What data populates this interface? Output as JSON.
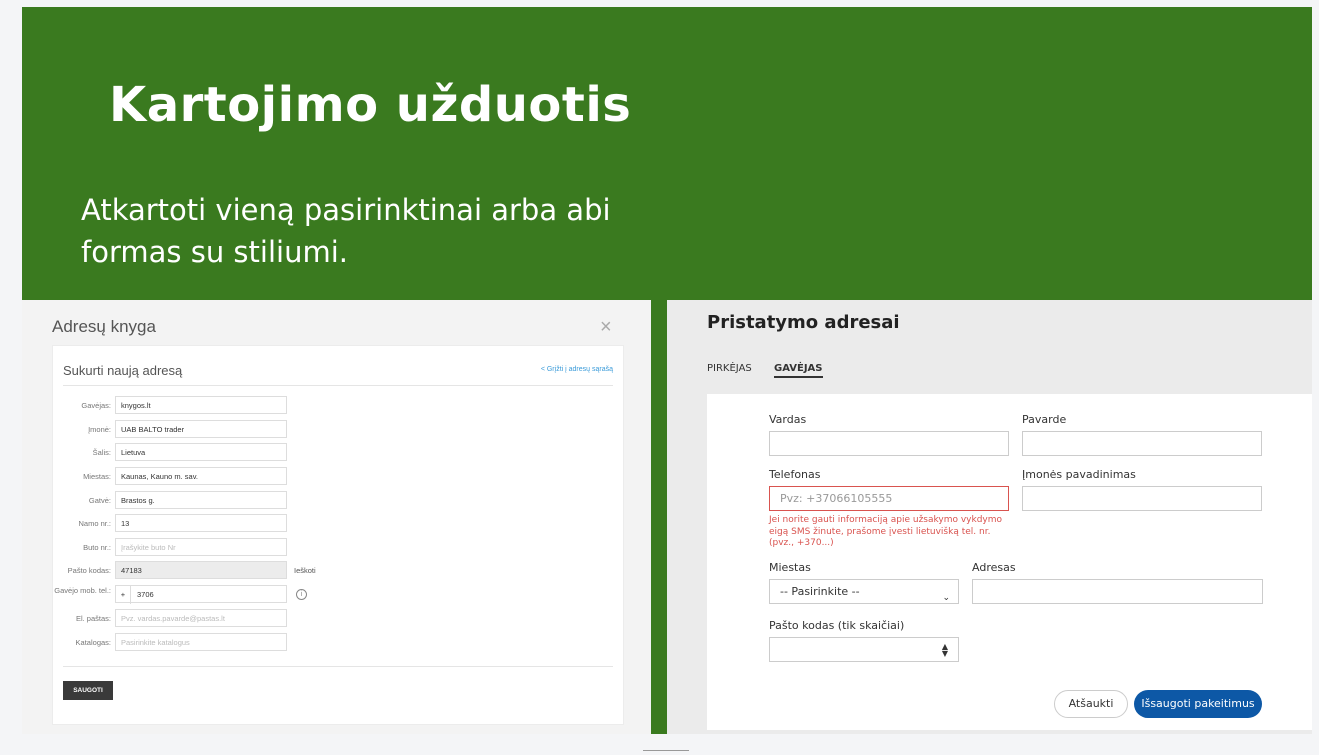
{
  "slide": {
    "title": "Kartojimo užduotis",
    "subtitle_line1": "Atkartoti vieną pasirinktinai arba abi",
    "subtitle_line2": "formas su stiliumi.",
    "bg_color": "#3a7a1f"
  },
  "left_form": {
    "modal_title": "Adresų knyga",
    "close_icon": "×",
    "heading": "Sukurti naują adresą",
    "back_link": "< Grįžti į adresų sąrašą",
    "fields": [
      {
        "label": "Gavėjas:",
        "value": "knygos.lt"
      },
      {
        "label": "Įmonė:",
        "value": "UAB BALTO trader"
      },
      {
        "label": "Šalis:",
        "value": "Lietuva"
      },
      {
        "label": "Miestas:",
        "value": "Kaunas, Kauno m. sav."
      },
      {
        "label": "Gatvė:",
        "value": "Brastos g."
      },
      {
        "label": "Namo nr.:",
        "value": "13"
      },
      {
        "label": "Buto nr.:",
        "placeholder": "Įrašykite buto Nr"
      },
      {
        "label": "Pašto kodas:",
        "value": "47183",
        "extra": "Ieškoti"
      },
      {
        "label": "Gavėjo mob. tel.:",
        "prefix": "+",
        "value": "3706"
      },
      {
        "label": "El. paštas:",
        "placeholder": "Pvz. vardas.pavarde@pastas.lt"
      },
      {
        "label": "Katalogas:",
        "placeholder": "Pasirinkite katalogus"
      }
    ],
    "save_button": "SAUGOTI"
  },
  "right_form": {
    "title": "Pristatymo adresai",
    "tabs": [
      "PIRKĖJAS",
      "GAVĖJAS"
    ],
    "active_tab": "GAVĖJAS",
    "vardas_label": "Vardas",
    "pavarde_label": "Pavarde",
    "telefonas_label": "Telefonas",
    "telefonas_placeholder": "Pvz: +37066105555",
    "telefonas_error": "Jei norite gauti informaciją apie užsakymo vykdymo eigą SMS žinute, prašome įvesti lietuvišką tel. nr. (pvz., +370...)",
    "imones_label": "Įmonės pavadinimas",
    "miestas_label": "Miestas",
    "miestas_select": "-- Pasirinkite --",
    "adresas_label": "Adresas",
    "pasto_kodas_label": "Pašto kodas (tik skaičiai)",
    "cancel_button": "Atšaukti",
    "save_button": "Išsaugoti pakeitimus",
    "accent_color": "#0d58a6",
    "error_color": "#d9534f"
  }
}
